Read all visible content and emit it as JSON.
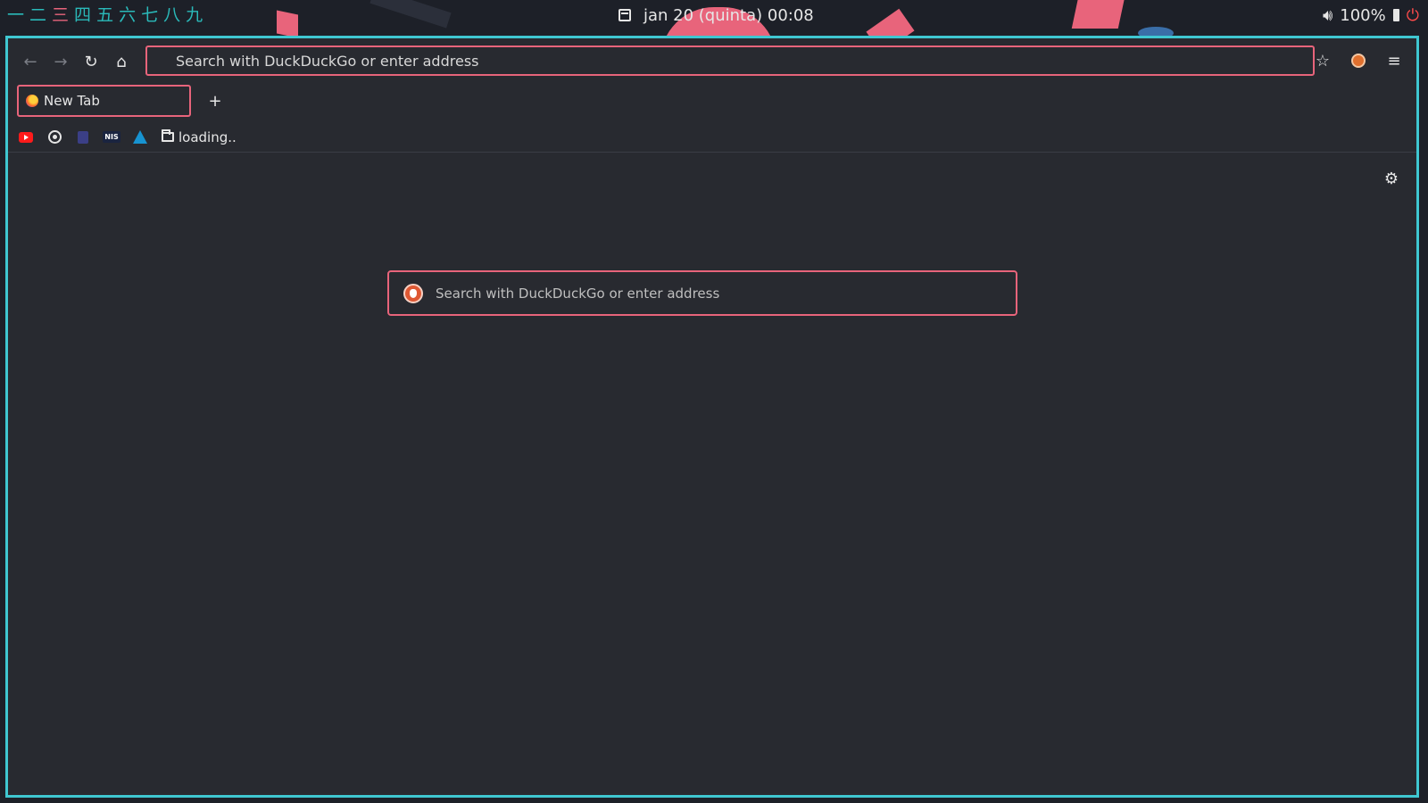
{
  "topbar": {
    "workspaces": [
      "一",
      "二",
      "三",
      "四",
      "五",
      "六",
      "七",
      "八",
      "九"
    ],
    "active_workspace_index": 2,
    "clock": "jan 20 (quinta) 00:08",
    "volume": "100%"
  },
  "browser": {
    "url_placeholder": "Search with DuckDuckGo or enter address",
    "tab_title": "New Tab",
    "new_tab_symbol": "+",
    "bookmark_folder": "loading..",
    "bookmark_nis_text": "NIS",
    "content_search_placeholder": "Search with DuckDuckGo or enter address"
  },
  "icons": {
    "back": "back-arrow-icon",
    "forward": "forward-arrow-icon",
    "reload": "reload-icon",
    "home": "home-icon",
    "bookmark_star": "bookmark-star-icon",
    "extension": "duckduckgo-extension-icon",
    "menu": "hamburger-menu-icon",
    "settings": "gear-icon"
  },
  "colors": {
    "accent": "#e8647b",
    "window_border": "#3fc7d1",
    "workspace": "#2ab9b9",
    "power": "#ff4b4b",
    "background": "#282a30"
  }
}
